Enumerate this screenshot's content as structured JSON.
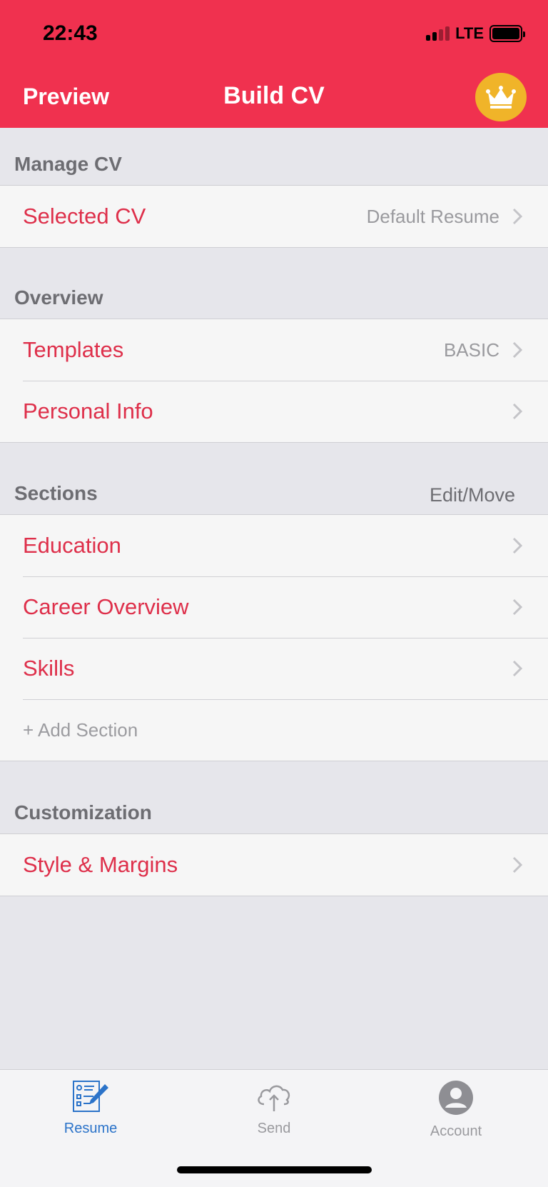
{
  "status_bar": {
    "time": "22:43",
    "network": "LTE"
  },
  "nav": {
    "left_label": "Preview",
    "title": "Build CV",
    "premium_icon": "crown-icon"
  },
  "colors": {
    "accent": "#f0314f",
    "text_red": "#de2f4a",
    "tab_active": "#2b73c9",
    "crown_bg": "#f0b429"
  },
  "manage": {
    "header": "Manage CV",
    "rows": [
      {
        "label": "Selected CV",
        "value": "Default Resume"
      }
    ]
  },
  "overview": {
    "header": "Overview",
    "rows": [
      {
        "label": "Templates",
        "value": "BASIC"
      },
      {
        "label": "Personal Info",
        "value": ""
      }
    ]
  },
  "sections": {
    "header": "Sections",
    "action": "Edit/Move",
    "rows": [
      {
        "label": "Education"
      },
      {
        "label": "Career Overview"
      },
      {
        "label": "Skills"
      }
    ],
    "add_label": "+ Add Section"
  },
  "customization": {
    "header": "Customization",
    "rows": [
      {
        "label": "Style & Margins"
      }
    ]
  },
  "tabs": [
    {
      "label": "Resume",
      "icon": "resume-icon",
      "active": true
    },
    {
      "label": "Send",
      "icon": "cloud-upload-icon",
      "active": false
    },
    {
      "label": "Account",
      "icon": "account-icon",
      "active": false
    }
  ]
}
